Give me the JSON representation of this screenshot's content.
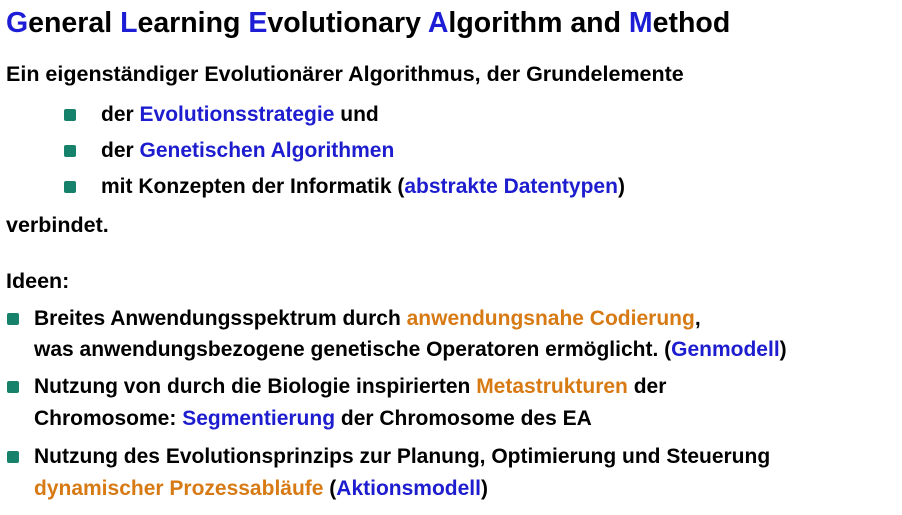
{
  "title": {
    "g": "G",
    "g_rest": "eneral ",
    "l": "L",
    "l_rest": "earning ",
    "e": "E",
    "e_rest": "volutionary ",
    "a": "A",
    "a_rest": "lgorithm and ",
    "m": "M",
    "m_rest": "ethod"
  },
  "intro": "Ein eigenständiger Evolutionärer Algorithmus, der Grundelemente",
  "sub_items": [
    {
      "pre": "der ",
      "hl": "Evolutionsstrategie",
      "post": " und"
    },
    {
      "pre": "der ",
      "hl": "Genetischen Algorithmen",
      "post": ""
    },
    {
      "pre": "mit Konzepten der Informatik (",
      "hl": "abstrakte Datentypen",
      "post": ")"
    }
  ],
  "outro": "verbindet.",
  "ideas_heading": "Ideen:",
  "ideas": [
    {
      "l1_pre": "Breites Anwendungsspektrum durch ",
      "l1_hl": "anwendungsnahe Codierung",
      "l1_post": ",",
      "l2_pre": "was anwendungsbezogene genetische Operatoren ermöglicht. (",
      "l2_hl": "Genmodell",
      "l2_post": ")"
    },
    {
      "l1_pre": "Nutzung von durch die Biologie inspirierten ",
      "l1_hl": "Metastrukturen",
      "l1_post": " der",
      "l2_pre": "Chromosome: ",
      "l2_hl": "Segmentierung",
      "l2_post": " der Chromosome des EA"
    },
    {
      "l1": "Nutzung des Evolutionsprinzips zur Planung, Optimierung und Steuerung",
      "l2_hl1": "dynamischer Prozessabläufe",
      "l2_mid": " (",
      "l2_hl2": "Aktionsmodell",
      "l2_post": ")"
    }
  ],
  "colors": {
    "title_initial": "#1d1dd6",
    "blue_highlight": "#1d1dcf",
    "orange_highlight": "#d77a14",
    "bullet": "#16826b"
  }
}
